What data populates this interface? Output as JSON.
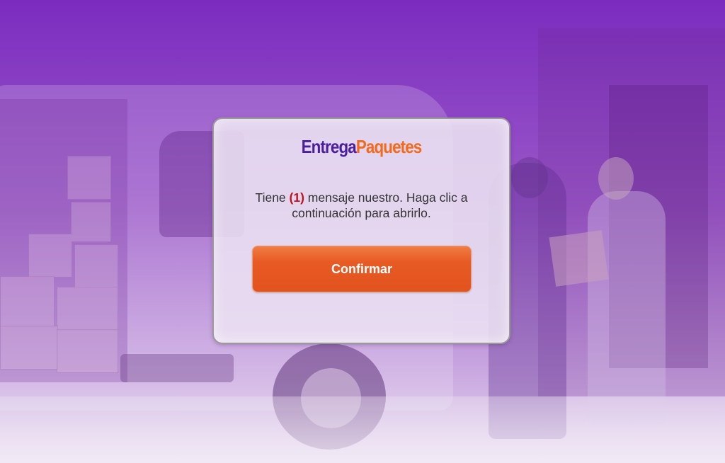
{
  "brand": {
    "name_part1": "Entrega",
    "name_part2": "Paquetes",
    "color_part1": "#4b1ea0",
    "color_part2": "#f26a1b"
  },
  "dialog": {
    "message_before": "Tiene ",
    "message_count": "(1)",
    "message_after": " mensaje nuestro. Haga clic a continuación para abrirlo.",
    "count_color": "#c0111a",
    "confirm_label": "Confirmar",
    "confirm_color": "#e85a24"
  },
  "background": {
    "overlay_color": "#8e44c4"
  }
}
